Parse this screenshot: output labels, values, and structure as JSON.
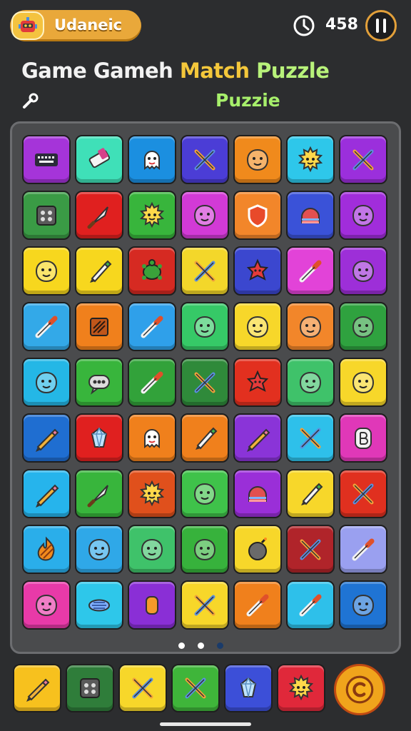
{
  "header": {
    "username": "Udaneic",
    "timer": "458"
  },
  "title": {
    "part1": "Game Gameh ",
    "part2": "Match",
    "part3": " Puzzle",
    "subtitle": "Puzzie"
  },
  "board": {
    "rows": [
      [
        {
          "color": "#a534d9",
          "icon": "keyboard-icon"
        },
        {
          "color": "#3fe0b8",
          "icon": "eraser-icon"
        },
        {
          "color": "#1b8fe0",
          "icon": "ghost-icon"
        },
        {
          "color": "#4b3dd6",
          "icon": "crossed-swords-icon"
        },
        {
          "color": "#f08a1c",
          "icon": "blob-face-icon"
        },
        {
          "color": "#2ec7ea",
          "icon": "sun-face-icon"
        },
        {
          "color": "#9b2fdc",
          "icon": "crossed-swords-icon"
        }
      ],
      [
        {
          "color": "#3a9b45",
          "icon": "speaker-box-icon"
        },
        {
          "color": "#e0201f",
          "icon": "knife-icon"
        },
        {
          "color": "#38b53c",
          "icon": "sun-face-icon"
        },
        {
          "color": "#d23ad6",
          "icon": "blob-face-icon"
        },
        {
          "color": "#f2862a",
          "icon": "shield-icon"
        },
        {
          "color": "#3a52d8",
          "icon": "dome-icon"
        },
        {
          "color": "#a12ddb",
          "icon": "blob-face-icon"
        }
      ],
      [
        {
          "color": "#f7d71e",
          "icon": "blob-face-icon"
        },
        {
          "color": "#f7d71e",
          "icon": "pen-icon"
        },
        {
          "color": "#d62a22",
          "icon": "turtle-icon"
        },
        {
          "color": "#f3d72a",
          "icon": "crossed-swords-icon"
        },
        {
          "color": "#3b47cf",
          "icon": "star-blob-icon"
        },
        {
          "color": "#e243d8",
          "icon": "brush-icon"
        },
        {
          "color": "#9d2fd8",
          "icon": "blob-face-icon"
        }
      ],
      [
        {
          "color": "#33a9e8",
          "icon": "brush-icon"
        },
        {
          "color": "#f0801c",
          "icon": "box-icon"
        },
        {
          "color": "#2fa0ea",
          "icon": "brush-icon"
        },
        {
          "color": "#36c967",
          "icon": "blob-face-icon"
        },
        {
          "color": "#f7d72a",
          "icon": "blob-face-icon"
        },
        {
          "color": "#f2862a",
          "icon": "blob-face-icon"
        },
        {
          "color": "#2fa23f",
          "icon": "blob-face-icon"
        }
      ],
      [
        {
          "color": "#24b7e6",
          "icon": "blob-face-icon"
        },
        {
          "color": "#38b53c",
          "icon": "speech-bubble-icon"
        },
        {
          "color": "#32a23a",
          "icon": "brush-icon"
        },
        {
          "color": "#2f8a3a",
          "icon": "crossed-swords-icon"
        },
        {
          "color": "#e2301f",
          "icon": "star-blob-icon"
        },
        {
          "color": "#3fc26a",
          "icon": "blob-face-icon"
        },
        {
          "color": "#f7d72a",
          "icon": "blob-face-icon"
        }
      ],
      [
        {
          "color": "#1f6ed1",
          "icon": "pencil-icon"
        },
        {
          "color": "#e0201f",
          "icon": "gem-icon"
        },
        {
          "color": "#f0801c",
          "icon": "ghost-icon"
        },
        {
          "color": "#f0801c",
          "icon": "pen-icon"
        },
        {
          "color": "#8a34d8",
          "icon": "pencil-icon"
        },
        {
          "color": "#2ec0ea",
          "icon": "crossed-swords-icon"
        },
        {
          "color": "#e038b8",
          "icon": "letter-b-icon"
        }
      ],
      [
        {
          "color": "#26b4ec",
          "icon": "pencil-icon"
        },
        {
          "color": "#38b53c",
          "icon": "knife-icon"
        },
        {
          "color": "#e0501c",
          "icon": "sun-face-icon"
        },
        {
          "color": "#3fc24a",
          "icon": "blob-face-icon"
        },
        {
          "color": "#9a2fd8",
          "icon": "dome-icon"
        },
        {
          "color": "#f7d72a",
          "icon": "pen-icon"
        },
        {
          "color": "#e0301f",
          "icon": "crossed-swords-icon"
        }
      ],
      [
        {
          "color": "#2aaeea",
          "icon": "flame-icon"
        },
        {
          "color": "#2fa8e8",
          "icon": "blob-face-icon"
        },
        {
          "color": "#3fc26a",
          "icon": "blob-face-icon"
        },
        {
          "color": "#37b23c",
          "icon": "blob-face-icon"
        },
        {
          "color": "#f7d72a",
          "icon": "bomb-icon"
        },
        {
          "color": "#b0242a",
          "icon": "crossed-swords-icon"
        },
        {
          "color": "#9aa0f0",
          "icon": "brush-icon"
        }
      ],
      [
        {
          "color": "#e83aa8",
          "icon": "blob-face-icon"
        },
        {
          "color": "#2ec7ea",
          "icon": "shell-icon"
        },
        {
          "color": "#8a2fd6",
          "icon": "capsule-icon"
        },
        {
          "color": "#f7d72a",
          "icon": "crossed-swords-icon"
        },
        {
          "color": "#f0801c",
          "icon": "brush-icon"
        },
        {
          "color": "#2ec0ea",
          "icon": "brush-icon"
        },
        {
          "color": "#1f74d4",
          "icon": "blob-face-icon"
        }
      ]
    ],
    "page_count": 3,
    "active_page": 3
  },
  "tray": [
    {
      "color": "#f7c11e",
      "icon": "pencil-icon"
    },
    {
      "color": "#2f7d3a",
      "icon": "speaker-box-icon"
    },
    {
      "color": "#f7d72a",
      "icon": "crossed-swords-icon"
    },
    {
      "color": "#3fb53a",
      "icon": "crossed-swords-icon"
    },
    {
      "color": "#3c4fd8",
      "icon": "gem-icon"
    },
    {
      "color": "#e0283a",
      "icon": "sun-face-icon"
    }
  ]
}
